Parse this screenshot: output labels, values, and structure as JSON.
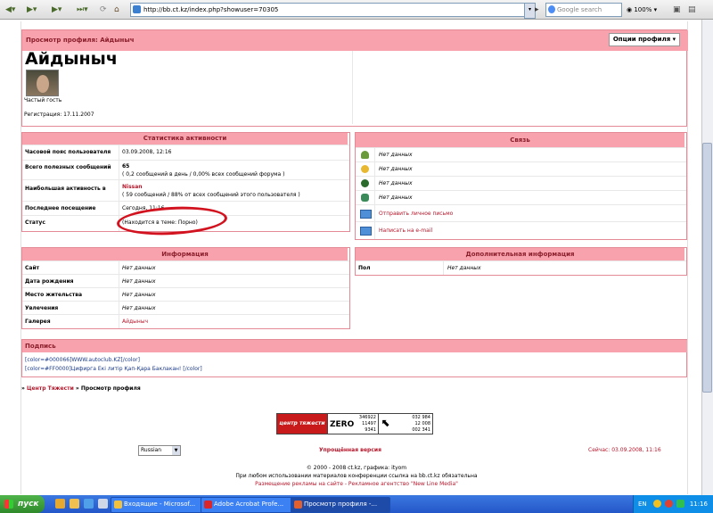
{
  "browser": {
    "url": "http://bb.ct.kz/index.php?showuser=70305",
    "search_placeholder": "Google search",
    "zoom": "100%"
  },
  "profile": {
    "header_title": "Просмотр профиля: Айдыныч",
    "options_button": "Опции профиля ▾",
    "username": "Айдыныч",
    "group": "Частый гость",
    "registration": "Регистрация: 17.11.2007"
  },
  "activity": {
    "title": "Статистика активности",
    "rows": [
      {
        "label": "Часовой пояс пользователя",
        "value": "03.09.2008, 12:16",
        "sub": ""
      },
      {
        "label": "Всего полезных сообщений",
        "value": "65",
        "sub": "( 0,2 сообщений в день / 0,00% всех сообщений форума )"
      },
      {
        "label": "Наибольшая активность в",
        "value": "Nissan",
        "sub": "( 59 сообщений / 88% от всех сообщений этого пользователя )"
      },
      {
        "label": "Последнее посещение",
        "value": "Сегодня, 11:16",
        "sub": ""
      },
      {
        "label": "Статус",
        "value": "(Находится в теме: Порно)",
        "sub": ""
      }
    ]
  },
  "contact": {
    "title": "Связь",
    "items": [
      {
        "icon": "icq-icon",
        "text": "Нет данных"
      },
      {
        "icon": "aim-icon",
        "text": "Нет данных"
      },
      {
        "icon": "yahoo-icon",
        "text": "Нет данных"
      },
      {
        "icon": "msn-icon",
        "text": "Нет данных"
      },
      {
        "icon": "envelope-icon",
        "text": "Отправить личное письмо"
      },
      {
        "icon": "envelope-icon",
        "text": "Написать на e-mail"
      }
    ]
  },
  "info": {
    "title": "Информация",
    "rows": [
      {
        "label": "Сайт",
        "value": "Нет данных"
      },
      {
        "label": "Дата рождения",
        "value": "Нет данных"
      },
      {
        "label": "Место жительства",
        "value": "Нет данных"
      },
      {
        "label": "Увлечения",
        "value": "Нет данных"
      },
      {
        "label": "Галерея",
        "value": "Айдыныч"
      }
    ]
  },
  "extra": {
    "title": "Дополнительная информация",
    "rows": [
      {
        "label": "Пол",
        "value": "Нет данных"
      }
    ]
  },
  "signature": {
    "title": "Подпись",
    "line1": "[color=#000066]WWW.autoclub.KZ[/color]",
    "line2": "[color=#FF0000]Цифирга Екі литір Қап-Қара Баклакан! [/color]"
  },
  "breadcrumb": {
    "link": "Центр Тяжести",
    "current": "Просмотр профиля"
  },
  "footer": {
    "language": "Russian",
    "lite_version": "Упрощённая версия",
    "now": "Сейчас: 03.09.2008, 11:16",
    "copyright": "© 2000 - 2008 ct.kz, графика: ityom",
    "notice": "При любом использовании материалов конференции ссылка на bb.ct.kz обязательна",
    "ads": "Размещение рекламы на сайте - Рекламное агентство \"New Line Media\"",
    "badge_site": "центр тяжести",
    "counter_zero": "ZERO",
    "counter_nums": [
      "346922",
      "11497",
      "9341"
    ],
    "counter2": [
      "032 984",
      "12 008",
      "002 341"
    ]
  },
  "taskbar": {
    "start": "пуск",
    "tasks": [
      "Входящие - Microsof...",
      "Adobe Acrobat Profe...",
      "Просмотр профиля -..."
    ],
    "lang": "EN",
    "clock": "11:16"
  }
}
